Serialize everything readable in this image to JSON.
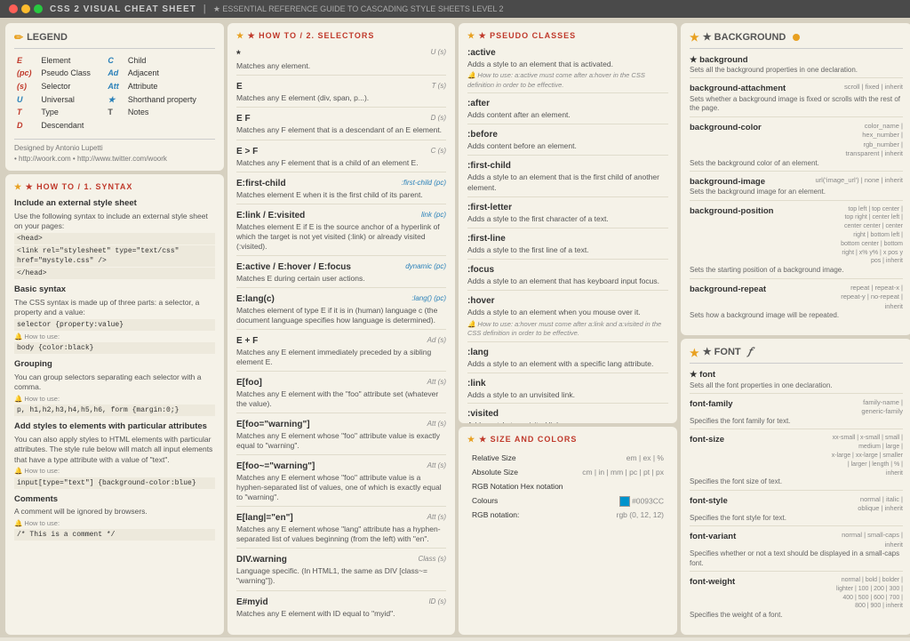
{
  "titleBar": {
    "title": "CSS 2 VISUAL CHEAT SHEET",
    "subtitle": "★ ESSENTIAL REFERENCE GUIDE TO CASCADING STYLE SHEETS LEVEL 2"
  },
  "legend": {
    "title": "LEGEND",
    "items": [
      {
        "abbr": "E",
        "label": "Element",
        "abbr2": "C",
        "label2": "Child"
      },
      {
        "abbr": "(pc)",
        "label": "Pseudo Class",
        "abbr2": "Ad",
        "label2": "Adjacent"
      },
      {
        "abbr": "(s)",
        "label": "Selector",
        "abbr2": "Att",
        "label2": "Attribute"
      },
      {
        "abbr": "U",
        "label": "Universal",
        "abbr2": "*",
        "label2": "Shorthand property"
      },
      {
        "abbr": "T",
        "label": "Type",
        "abbr2": "T",
        "label2": "Notes"
      },
      {
        "abbr": "D",
        "label": "Descendant"
      }
    ],
    "designedBy": "Designed by Antonio Lupetti",
    "links": "• http://woork.com • http://www.twitter.com/woork"
  },
  "howToSyntax": {
    "sectionTitle": "★ HOW TO / 1. SYNTAX",
    "sections": [
      {
        "title": "Include an external style sheet",
        "desc": "Use the following syntax to include an external style sheet on your pages:",
        "codes": [
          "<head>",
          "<link rel=\"stylesheet\" type=\"text/css\" href=\"mystyle.css\" />",
          "</head>"
        ]
      },
      {
        "title": "Basic syntax",
        "desc": "The CSS syntax is made up of three parts: a selector, a property and a value:",
        "codes": [
          "selector {property:value}"
        ],
        "howto": "body {color:black}"
      },
      {
        "title": "Grouping",
        "desc": "You can group selectors separating each selector with a comma.",
        "howto": "p, h1,h2,h3,h4,h5,h6, form {margin:0;}"
      },
      {
        "title": "Add styles to elements with particular attributes",
        "desc": "You can also apply styles to HTML elements with particular attributes. The style rule below will match all input elements that have a type attribute with a value of \"text\".",
        "howto": "input[type=\"text\"] {background-color:blue}"
      },
      {
        "title": "Comments",
        "desc": "A comment will be ignored by browsers.",
        "howto": "/* This is a comment */"
      }
    ]
  },
  "howToSelectors": {
    "sectionTitle": "★ HOW TO / 2. SELECTORS",
    "items": [
      {
        "name": "*",
        "desc": "Matches any element.",
        "badge": "U (s)"
      },
      {
        "name": "E",
        "desc": "Matches any E element (div, span, p...).",
        "badge": "T (s)"
      },
      {
        "name": "E F",
        "desc": "Matches any F element that is a descendant of an E element.",
        "badge": "D (s)"
      },
      {
        "name": "E > F",
        "desc": "Matches any F element that is a child of an element E.",
        "badge": "C (s)"
      },
      {
        "name": "E:first-child",
        "desc": "Matches element E when it is the first child of its parent.",
        "badge": ":first-child (pc)",
        "badgeColor": "blue"
      },
      {
        "name": "E:link / E:visited",
        "desc": "Matches element E if E is the source anchor of a hyperlink of which the target is not yet visited (:link) or already visited (:visited).",
        "badge": "link (pc)",
        "badgeColor": "blue"
      },
      {
        "name": "E:active / E:hover / E:focus",
        "desc": "Matches E during certain user actions.",
        "badge": "dynamic (pc)",
        "badgeColor": "blue"
      },
      {
        "name": "E:lang(c)",
        "desc": "Matches element of type E if it is in (human) language c (the document language specifies how language is determined).",
        "badge": ":lang() (pc)",
        "badgeColor": "blue"
      },
      {
        "name": "E + F",
        "desc": "Matches any E element immediately preceded by a sibling element E.",
        "badge": "Ad (s)"
      },
      {
        "name": "E[foo]",
        "desc": "Matches any E element with the \"foo\" attribute set (whatever the value).",
        "badge": "Att (s)"
      },
      {
        "name": "E[foo=\"warning\"]",
        "desc": "Matches any E element whose \"foo\" attribute value is exactly equal to \"warning\".",
        "badge": "Att (s)"
      },
      {
        "name": "E[foo~=\"warning\"]",
        "desc": "Matches any E element whose \"foo\" attribute value is a hyphen-separated list of values, one of which is exactly equal to \"warning\".",
        "badge": "Att (s)"
      },
      {
        "name": "E[lang|=\"en\"]",
        "desc": "Matches any E element whose \"lang\" attribute has a hyphen-separated list of values beginning (from the left) with \"en\".",
        "badge": "Att (s)"
      },
      {
        "name": "DIV.warning",
        "desc": "Language specific. (In HTML1, the same as DIV [class~= \"warning\"]).",
        "badge": "Class (s)"
      },
      {
        "name": "E#myid",
        "desc": "Matches any E element with ID equal to \"myid\".",
        "badge": "ID (s)"
      }
    ]
  },
  "pseudoClasses": {
    "sectionTitle": "★ PSEUDO CLASSES",
    "items": [
      {
        "name": ":active",
        "desc": "Adds a style to an element that is activated."
      },
      {
        "name": ":after",
        "desc": "Adds content after an element."
      },
      {
        "name": ":before",
        "desc": "Adds content before an element."
      },
      {
        "name": ":first-child",
        "desc": "Adds a style to an element that is the first child of another element."
      },
      {
        "name": ":first-letter",
        "desc": "Adds a style to the first character of a text."
      },
      {
        "name": ":first-line",
        "desc": "Adds a style to the first line of a text."
      },
      {
        "name": ":focus",
        "desc": "Adds a style to an element that has keyboard input focus."
      },
      {
        "name": ":hover",
        "desc": "Adds a style to an element when you mouse over it.",
        "howto": "a:hover must come after a:link and a:visited in the CSS definition in order to be effective."
      },
      {
        "name": ":lang",
        "desc": "Adds a style to an element with a specific lang attribute."
      },
      {
        "name": ":link",
        "desc": "Adds a style to an unvisited link."
      },
      {
        "name": ":visited",
        "desc": "Adds a style to a visited link."
      }
    ],
    "activehowto": "a:active must come after a:hover in the CSS definition in order to be effective."
  },
  "sizeAndColors": {
    "sectionTitle": "★ SIZE AND COLORS",
    "relativeSize": {
      "label": "Relative Size",
      "values": "em | ex | %"
    },
    "absoluteSize": {
      "label": "Absolute Size",
      "values": "cm | in | mm | pc | pt | px"
    },
    "hexNotation": {
      "label": "RGB Notation Hex notation",
      "values": "#0093CC"
    },
    "colours": {
      "label": "Colours",
      "colorHex": "#0093CC"
    },
    "rgbNotation": {
      "label": "RGB notation:",
      "values": "rgb (0, 12, 12)"
    }
  },
  "background": {
    "sectionTitle": "★ BACKGROUND",
    "properties": [
      {
        "name": "background",
        "bold": true,
        "desc": "Sets all the background properties in one declaration.",
        "values": ""
      },
      {
        "name": "background-attachment",
        "desc": "Sets whether a background image is fixed or scrolls with the rest of the page.",
        "values": "scroll | fixed | inherit"
      },
      {
        "name": "background-color",
        "desc": "Sets the background color of an element.",
        "values": "color_name | hex_number | rgb_number | transparent | inherit"
      },
      {
        "name": "background-image",
        "desc": "Sets the background image for an element.",
        "values": "url('image_url') | none | inherit"
      },
      {
        "name": "background-position",
        "desc": "Sets the starting position of a background image.",
        "values": "top left | top center | top right | center left | center center | center right | bottom left | bottom center | bottom right | x% y% | x pos y pos | inherit"
      },
      {
        "name": "background-repeat",
        "desc": "Sets how a background image will be repeated.",
        "values": "repeat | repeat-x | repeat-y | no-repeat | inherit"
      }
    ]
  },
  "font": {
    "sectionTitle": "★ FONT",
    "properties": [
      {
        "name": "font",
        "bold": true,
        "desc": "Sets all the font properties in one declaration.",
        "values": ""
      },
      {
        "name": "font-family",
        "desc": "Specifies the font family for text.",
        "values": "family-name | generic-family"
      },
      {
        "name": "font-size",
        "desc": "Specifies the font size of text.",
        "values": "xx-small | x-small | small | medium | large | x-large | xx-large | smaller | larger | length | % | inherit"
      },
      {
        "name": "font-style",
        "desc": "Specifies the font style for text.",
        "values": "normal | italic | oblique | inherit"
      },
      {
        "name": "font-variant",
        "desc": "Specifies whether or not a text should be displayed in a small-caps font.",
        "values": "normal | small-caps | inherit"
      },
      {
        "name": "font-weight",
        "desc": "Specifies the weight of a font.",
        "values": "normal | bold | bolder | lighter | 100 | 200 | 300 | 400 | 500 | 600 | 700 | 800 | 900 | inherit"
      }
    ]
  }
}
